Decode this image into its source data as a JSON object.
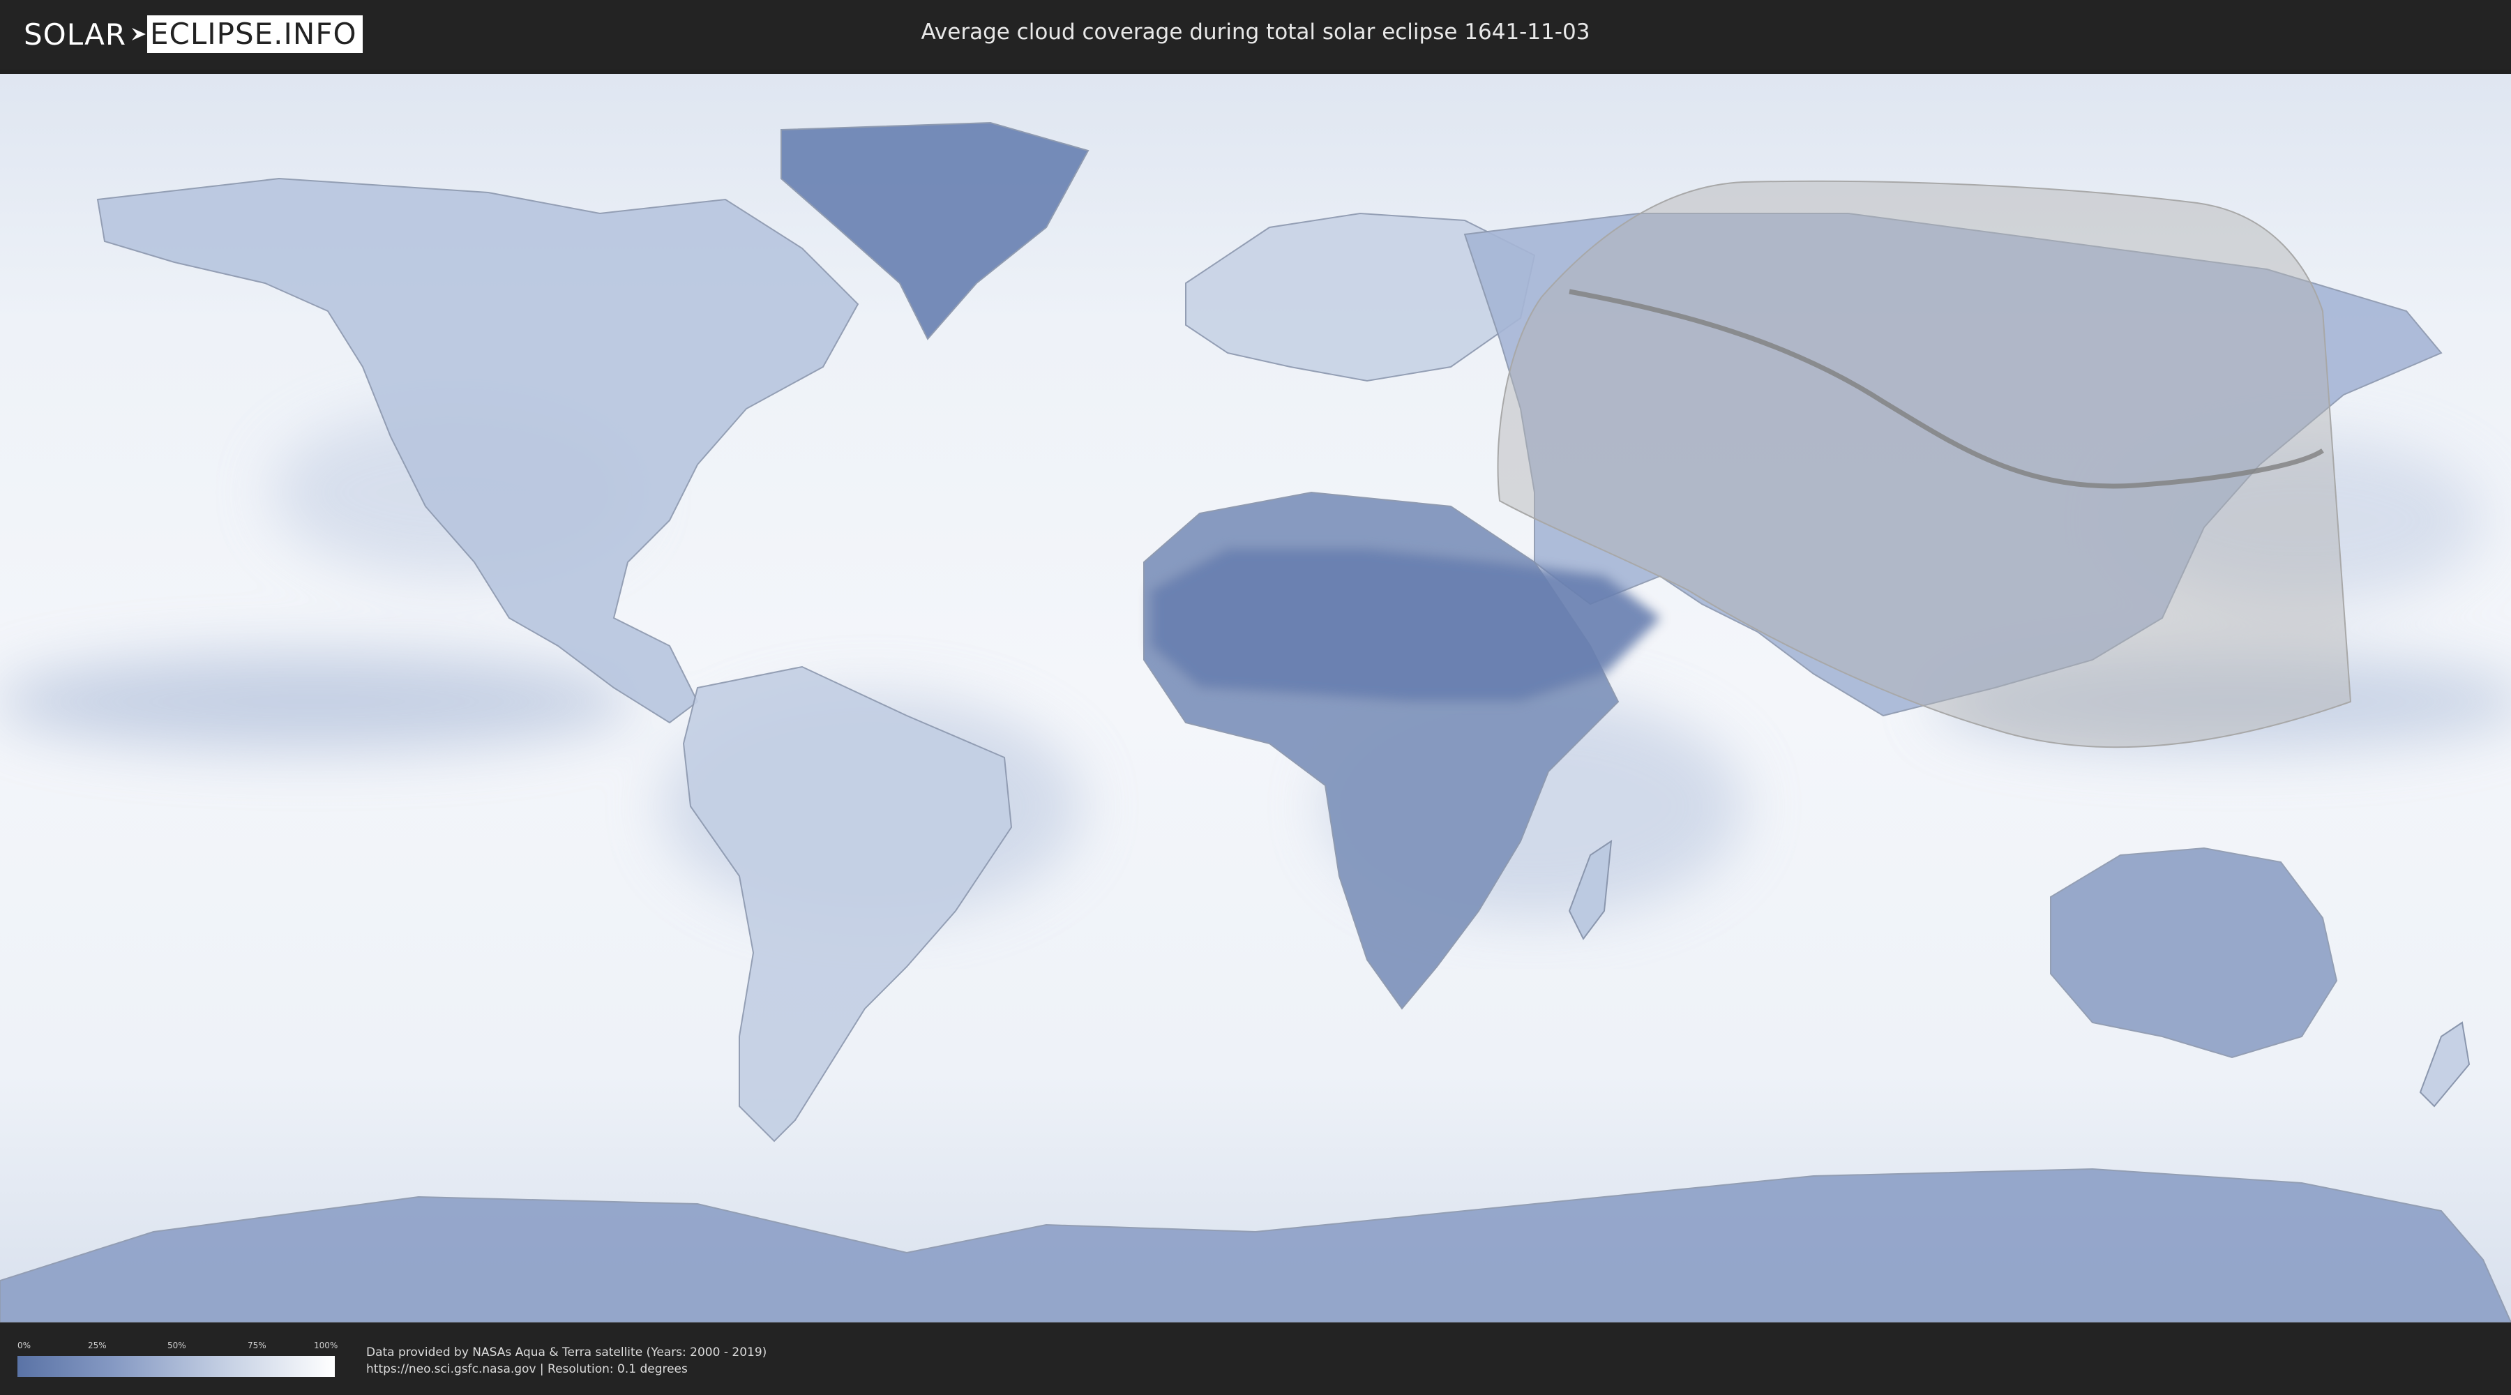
{
  "header": {
    "logo_left": "SOLAR",
    "logo_right": "ECLIPSE.INFO",
    "title": "Average cloud coverage during total solar eclipse 1641-11-03"
  },
  "legend": {
    "ticks": [
      "0%",
      "25%",
      "50%",
      "75%",
      "100%"
    ],
    "colors": [
      "#5a73a6",
      "#ffffff"
    ]
  },
  "footer": {
    "line1": "Data provided by NASAs Aqua & Terra satellite (Years: 2000 - 2019)",
    "line2": "https://neo.sci.gsfc.nasa.gov | Resolution: 0.1 degrees"
  },
  "colors": {
    "ocean_cloud": "#f1f4f9",
    "land_clear": "#7389b6",
    "eclipse_zone": "#bdbdbd"
  }
}
